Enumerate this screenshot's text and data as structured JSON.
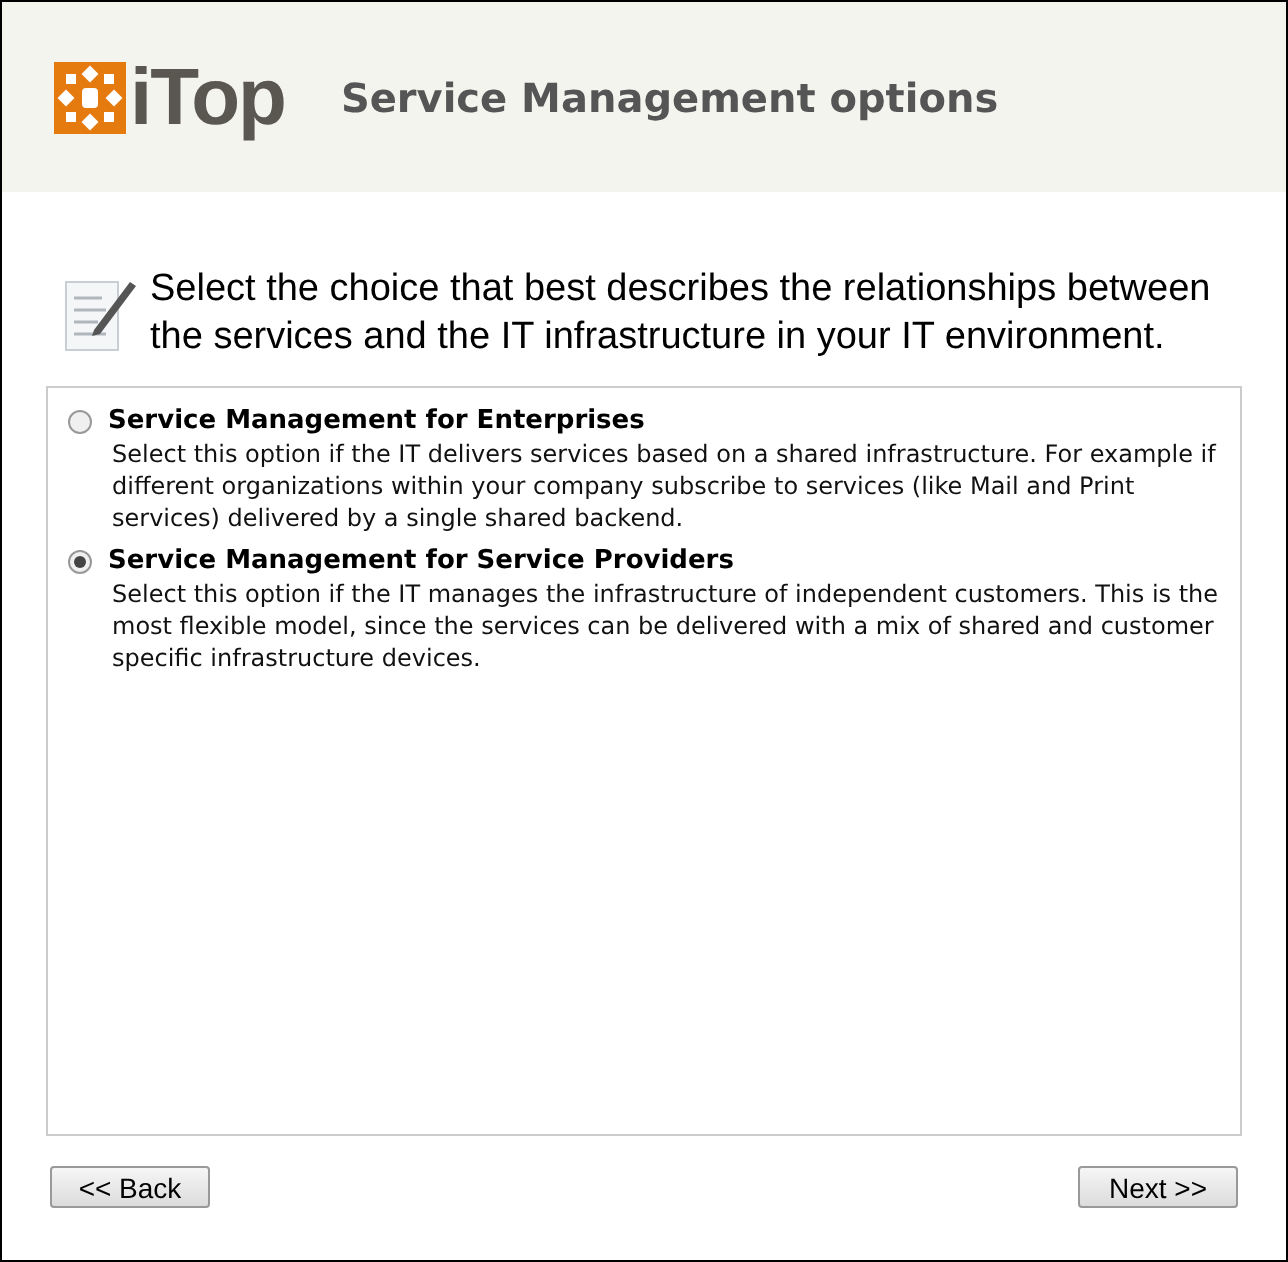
{
  "header": {
    "logo_text": "iTop",
    "title": "Service Management options"
  },
  "intro": "Select the choice that best describes the relationships between the services and the IT infrastructure in your IT environment.",
  "options": [
    {
      "label": "Service Management for Enterprises",
      "description": "Select this option if the IT delivers services based on a shared infrastructure. For example if different organizations within your company subscribe to services (like Mail and Print services) delivered by a single shared backend.",
      "selected": false
    },
    {
      "label": "Service Management for Service Providers",
      "description": "Select this option if the IT manages the infrastructure of independent customers. This is the most flexible model, since the services can be delivered with a mix of shared and customer specific infrastructure devices.",
      "selected": true
    }
  ],
  "buttons": {
    "back": "<< Back",
    "next": "Next >>"
  }
}
